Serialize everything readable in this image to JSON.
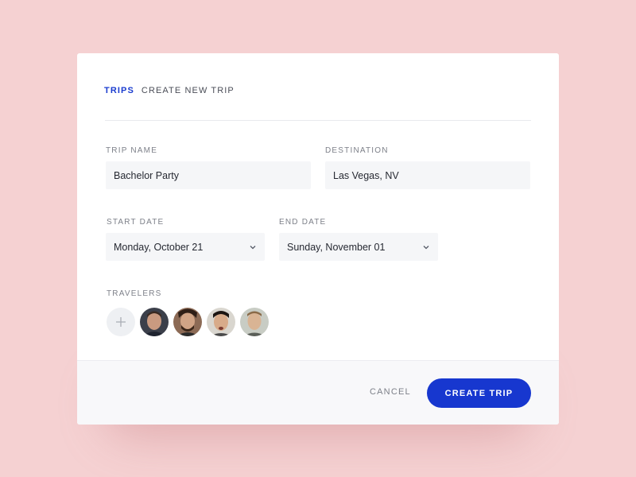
{
  "colors": {
    "background": "#f5d1d2",
    "accent": "#1737cf",
    "field_bg": "#f5f6f8",
    "footer_bg": "#f8f8fa"
  },
  "breadcrumb": {
    "root": "TRIPS",
    "current": "CREATE NEW TRIP"
  },
  "form": {
    "trip_name": {
      "label": "TRIP NAME",
      "value": "Bachelor Party"
    },
    "destination": {
      "label": "DESTINATION",
      "value": "Las Vegas, NV"
    },
    "start_date": {
      "label": "START DATE",
      "value": "Monday, October 21",
      "icon": "chevron-down-icon"
    },
    "end_date": {
      "label": "END DATE",
      "value": "Sunday, November 01",
      "icon": "chevron-down-icon"
    },
    "travelers": {
      "label": "TRAVELERS",
      "add_icon": "plus-icon",
      "people": [
        {
          "icon": "avatar-1"
        },
        {
          "icon": "avatar-2"
        },
        {
          "icon": "avatar-3"
        },
        {
          "icon": "avatar-4"
        }
      ]
    }
  },
  "footer": {
    "cancel_label": "CANCEL",
    "create_label": "CREATE TRIP"
  }
}
